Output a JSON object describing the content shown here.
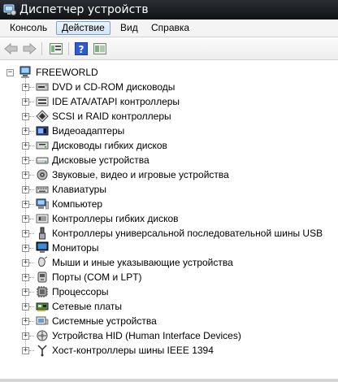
{
  "window": {
    "title": "Диспетчер устройств"
  },
  "menu": {
    "items": [
      {
        "label": "Консоль"
      },
      {
        "label": "Действие"
      },
      {
        "label": "Вид"
      },
      {
        "label": "Справка"
      }
    ],
    "active_index": 1
  },
  "toolbar": {
    "buttons": [
      "back-arrow-icon",
      "forward-arrow-icon",
      "properties-icon",
      "help-icon",
      "view-icon"
    ]
  },
  "tree": {
    "root": {
      "label": "FREEWORLD",
      "icon": "computer-icon",
      "expanded": true
    },
    "categories": [
      {
        "label": "DVD и CD-ROM дисководы",
        "icon": "dvd-drive-icon"
      },
      {
        "label": "IDE ATA/ATAPI контроллеры",
        "icon": "ide-controller-icon"
      },
      {
        "label": "SCSI и RAID контроллеры",
        "icon": "scsi-controller-icon"
      },
      {
        "label": "Видеоадаптеры",
        "icon": "display-adapter-icon"
      },
      {
        "label": "Дисководы гибких дисков",
        "icon": "floppy-drive-icon"
      },
      {
        "label": "Дисковые устройства",
        "icon": "disk-drive-icon"
      },
      {
        "label": "Звуковые, видео и игровые устройства",
        "icon": "sound-icon"
      },
      {
        "label": "Клавиатуры",
        "icon": "keyboard-icon"
      },
      {
        "label": "Компьютер",
        "icon": "computer-small-icon"
      },
      {
        "label": "Контроллеры гибких дисков",
        "icon": "floppy-controller-icon"
      },
      {
        "label": "Контроллеры универсальной последовательной шины USB",
        "icon": "usb-icon"
      },
      {
        "label": "Мониторы",
        "icon": "monitor-icon"
      },
      {
        "label": "Мыши и иные указывающие устройства",
        "icon": "mouse-icon"
      },
      {
        "label": "Порты (COM и LPT)",
        "icon": "port-icon"
      },
      {
        "label": "Процессоры",
        "icon": "processor-icon"
      },
      {
        "label": "Сетевые платы",
        "icon": "network-adapter-icon"
      },
      {
        "label": "Системные устройства",
        "icon": "system-device-icon"
      },
      {
        "label": "Устройства HID (Human Interface Devices)",
        "icon": "hid-icon"
      },
      {
        "label": "Хост-контроллеры шины IEEE 1394",
        "icon": "ieee1394-icon"
      }
    ]
  }
}
